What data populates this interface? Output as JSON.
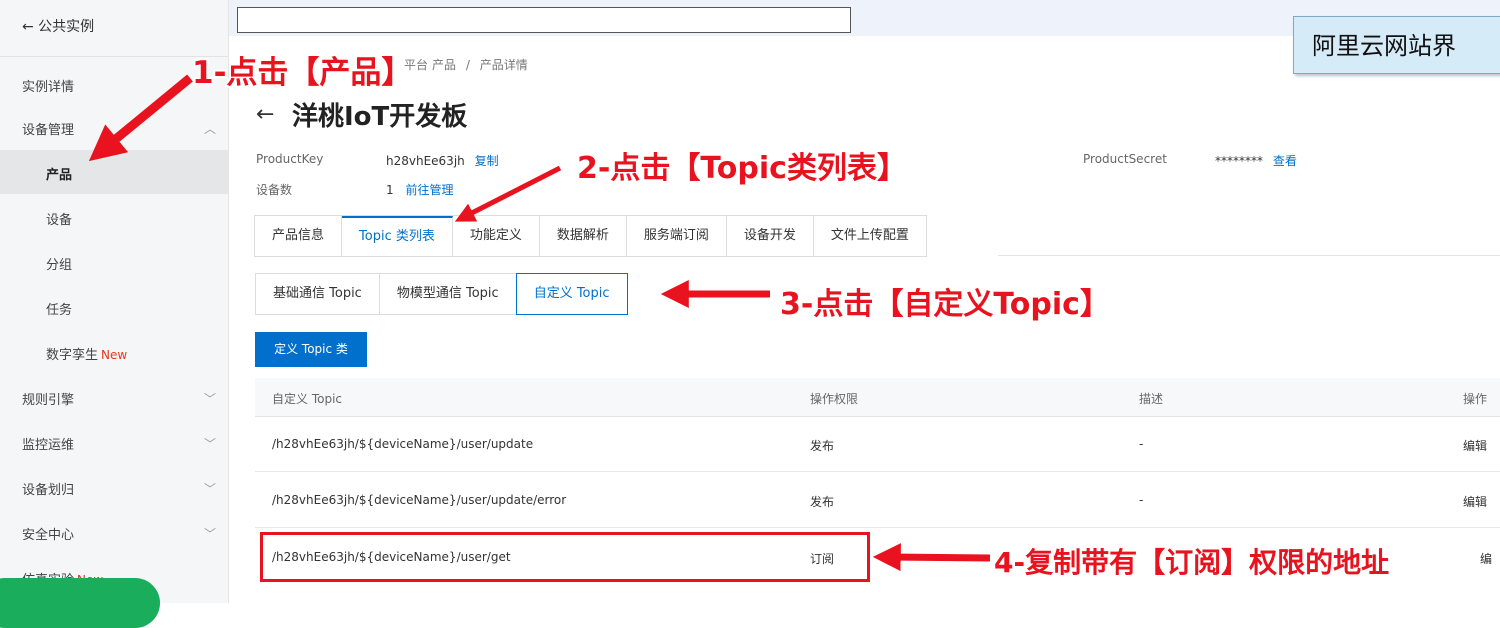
{
  "sidebar": {
    "back_label": "← 公共实例",
    "items": [
      {
        "label": "实例详情"
      },
      {
        "label": "设备管理"
      },
      {
        "label": "产品"
      },
      {
        "label": "设备"
      },
      {
        "label": "分组"
      },
      {
        "label": "任务"
      },
      {
        "label": "数字孪生",
        "badge": "New"
      },
      {
        "label": "规则引擎"
      },
      {
        "label": "监控运维"
      },
      {
        "label": "设备划归"
      },
      {
        "label": "安全中心"
      },
      {
        "label": "仿真实验",
        "badge": "New"
      }
    ]
  },
  "note": {
    "text": "阿里云网站界"
  },
  "breadcrumb": {
    "product": "产品",
    "sep": "/",
    "detail": "产品详情",
    "partial": "平台"
  },
  "header": {
    "title": "洋桃IoT开发板"
  },
  "meta": {
    "product_key_label": "ProductKey",
    "product_key_value": "h28vhEe63jh",
    "copy_link": "复制",
    "device_count_label": "设备数",
    "device_count_value": "1",
    "manage_link": "前往管理",
    "secret_label": "ProductSecret",
    "secret_value": "********",
    "view_link": "查看"
  },
  "tabs": [
    "产品信息",
    "Topic 类列表",
    "功能定义",
    "数据解析",
    "服务端订阅",
    "设备开发",
    "文件上传配置"
  ],
  "subtabs": [
    "基础通信 Topic",
    "物模型通信 Topic",
    "自定义 Topic"
  ],
  "define_button": "定义 Topic 类",
  "table": {
    "headers": [
      "自定义 Topic",
      "操作权限",
      "描述",
      "操作"
    ],
    "rows": [
      {
        "topic": "/h28vhEe63jh/${deviceName}/user/update",
        "permission": "发布",
        "desc": "-",
        "action": "编辑"
      },
      {
        "topic": "/h28vhEe63jh/${deviceName}/user/update/error",
        "permission": "发布",
        "desc": "-",
        "action": "编辑"
      },
      {
        "topic": "/h28vhEe63jh/${deviceName}/user/get",
        "permission": "订阅",
        "desc": "",
        "action": "编"
      }
    ]
  },
  "annotations": {
    "step1": "1-点击【产品】",
    "step2": "2-点击【Topic类列表】",
    "step3": "3-点击【自定义Topic】",
    "step4": "4-复制带有【订阅】权限的地址"
  },
  "colors": {
    "accent": "#0070cc",
    "annotation": "#e8131e"
  }
}
